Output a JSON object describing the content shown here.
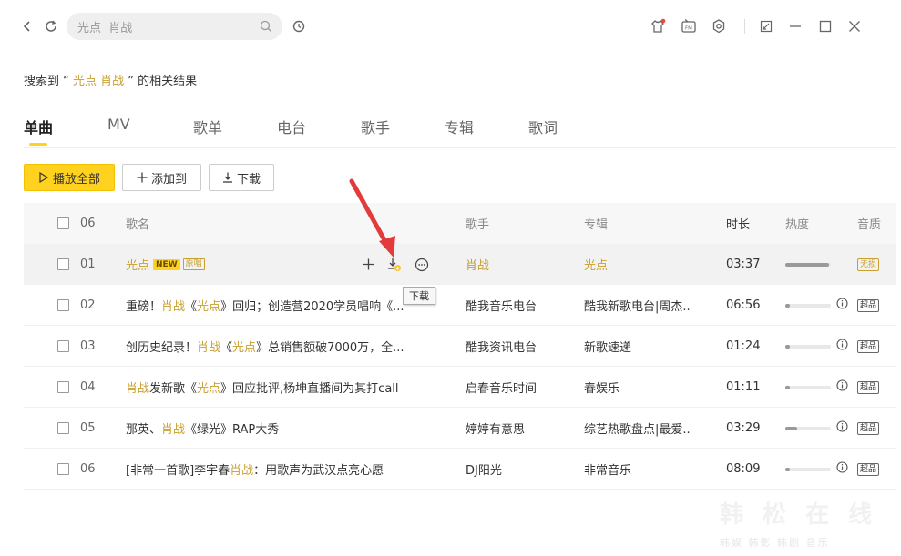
{
  "search": {
    "value": "光点  肖战",
    "placeholder": "光点  肖战"
  },
  "summary": {
    "prefix": "搜索到 “",
    "keyword": " 光点 肖战 ",
    "suffix": "” 的相关结果"
  },
  "tabs": [
    "单曲",
    "MV",
    "歌单",
    "电台",
    "歌手",
    "专辑",
    "歌词"
  ],
  "actions": {
    "play_all": "播放全部",
    "add_to": "添加到",
    "download": "下载"
  },
  "header": {
    "idx": "06",
    "title": "歌名",
    "singer": "歌手",
    "album": "专辑",
    "duration": "时长",
    "hot": "热度",
    "quality": "音质"
  },
  "rows": [
    {
      "idx": "01",
      "title_parts": [
        {
          "t": "光点",
          "gold": true
        }
      ],
      "new": "NEW",
      "orig": "原唱",
      "singer": "肖战",
      "singer_gold": true,
      "album": "光点",
      "album_gold": true,
      "duration": "03:37",
      "hot": 0.95,
      "quality": "无损",
      "quality_gold": true
    },
    {
      "idx": "02",
      "title_parts": [
        {
          "t": "重磅！",
          "gold": false
        },
        {
          "t": "肖战",
          "gold": true
        },
        {
          "t": "《",
          "gold": false
        },
        {
          "t": "光点",
          "gold": true
        },
        {
          "t": "》回归；创造营2020学员唱响《...",
          "gold": false
        }
      ],
      "singer": "酷我音乐电台",
      "album": "酷我新歌电台|周杰..",
      "duration": "06:56",
      "hot": 0.1,
      "quality": "超品"
    },
    {
      "idx": "03",
      "title_parts": [
        {
          "t": "创历史纪录！",
          "gold": false
        },
        {
          "t": "肖战",
          "gold": true
        },
        {
          "t": "《",
          "gold": false
        },
        {
          "t": "光点",
          "gold": true
        },
        {
          "t": "》总销售额破7000万，全...",
          "gold": false
        }
      ],
      "singer": "酷我资讯电台",
      "album": "新歌速递",
      "duration": "01:24",
      "hot": 0.1,
      "quality": "超品"
    },
    {
      "idx": "04",
      "title_parts": [
        {
          "t": "肖战",
          "gold": true
        },
        {
          "t": "发新歌《",
          "gold": false
        },
        {
          "t": "光点",
          "gold": true
        },
        {
          "t": "》回应批评,杨坤直播间为其打call",
          "gold": false
        }
      ],
      "singer": "启春音乐时间",
      "album": "春娱乐",
      "duration": "01:11",
      "hot": 0.1,
      "quality": "超品"
    },
    {
      "idx": "05",
      "title_parts": [
        {
          "t": "那英、",
          "gold": false
        },
        {
          "t": "肖战",
          "gold": true
        },
        {
          "t": "《绿光》RAP大秀",
          "gold": false
        }
      ],
      "singer": "婷婷有意思",
      "album": "综艺热歌盘点|最爱..",
      "duration": "03:29",
      "hot": 0.25,
      "quality": "超品"
    },
    {
      "idx": "06",
      "title_parts": [
        {
          "t": "[非常一首歌]李宇春 ",
          "gold": false
        },
        {
          "t": "肖战",
          "gold": true
        },
        {
          "t": "：用歌声为武汉点亮心愿",
          "gold": false
        }
      ],
      "singer": "DJ阳光",
      "album": "非常音乐",
      "duration": "08:09",
      "hot": 0.1,
      "quality": "超品"
    }
  ],
  "tooltip": "下载",
  "watermark": {
    "big": "韩 松 在 线",
    "small": "韩娱  韩影  韩剧  音乐"
  },
  "colors": {
    "accent": "#ffd21f",
    "keyword": "#c8a030"
  }
}
